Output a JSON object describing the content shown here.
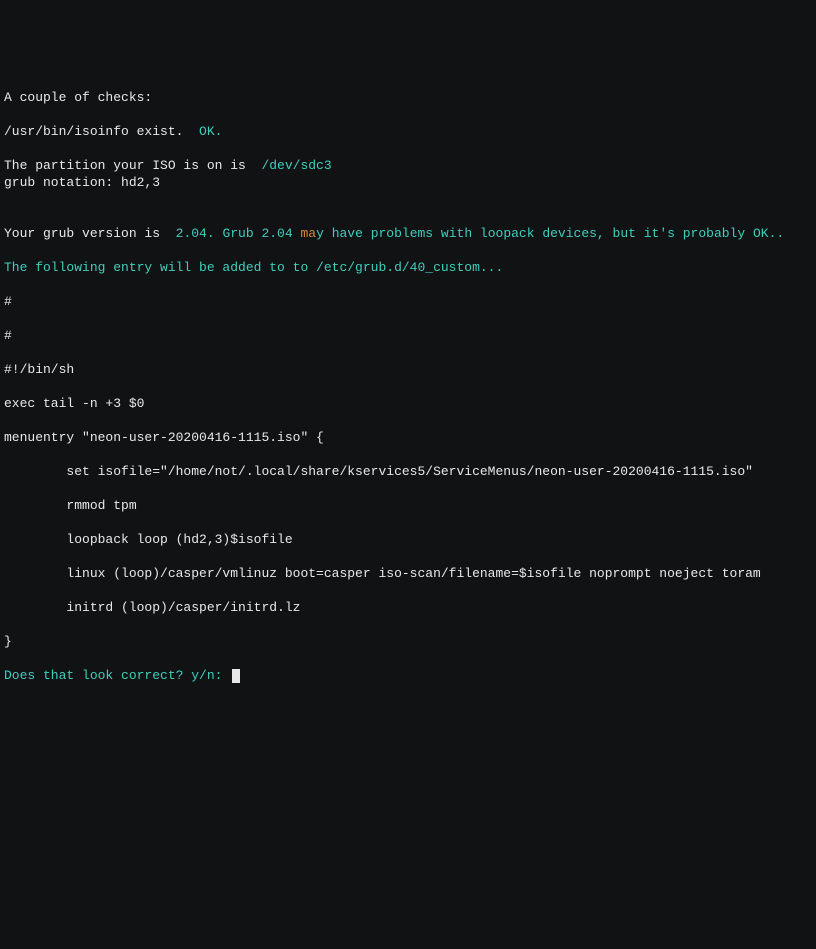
{
  "line1": "A couple of checks:",
  "line2a": "/usr/bin/isoinfo exist.  ",
  "line2b": "OK.",
  "line3": "",
  "line4a": "The partition your ISO is on is  ",
  "line4b": "/dev/sdc3",
  "line5": "grub notation: hd2,3",
  "line6": "",
  "line7a": "Your grub version is  ",
  "line7b": "2.04. Grub 2.04 ",
  "line7c": "ma",
  "line7d": "y",
  "line7e": " have problems with loopack devices, but it's probably OK..",
  "line8": "",
  "line9": "The following entry will be added to to /etc/grub.d/40_custom...",
  "line10": "#",
  "line11": "#",
  "line12": "#!/bin/sh",
  "line13": "exec tail -n +3 $0",
  "line14": "menuentry \"neon-user-20200416-1115.iso\" {",
  "line15": "        set isofile=\"/home/not/.local/share/kservices5/ServiceMenus/neon-user-20200416-1115.iso\"",
  "line16": "        rmmod tpm",
  "line17": "        loopback loop (hd2,3)$isofile",
  "line18": "        linux (loop)/casper/vmlinuz boot=casper iso-scan/filename=$isofile noprompt noeject toram",
  "line19": "        initrd (loop)/casper/initrd.lz",
  "line20": "}",
  "line21": "Does that look correct? y/n: "
}
